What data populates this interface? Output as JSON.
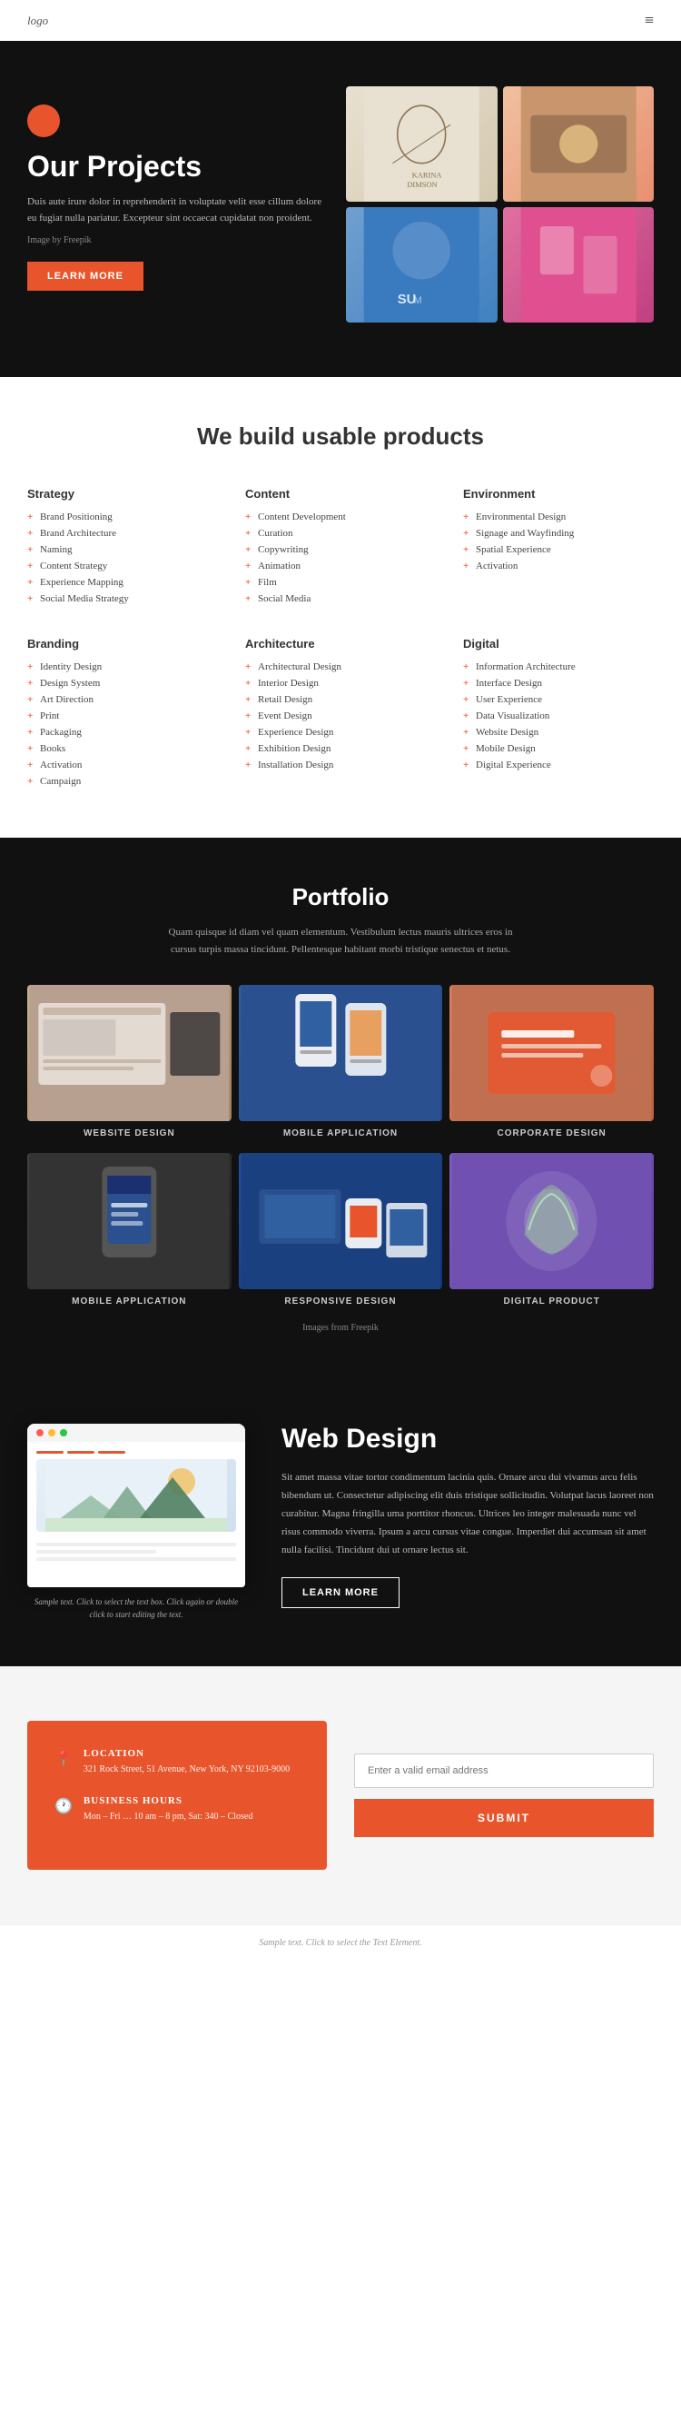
{
  "header": {
    "logo": "logo",
    "menu_icon": "≡"
  },
  "hero": {
    "title": "Our Projects",
    "description": "Duis aute irure dolor in reprehenderit in voluptate velit esse cillum dolore eu fugiat nulla pariatur. Excepteur sint occaecat cupidatat non proident.",
    "credit": "Image by Freepik",
    "btn_label": "LEARN MORE"
  },
  "services": {
    "section_title": "We build usable products",
    "columns": [
      {
        "heading": "Strategy",
        "items": [
          "Brand Positioning",
          "Brand Architecture",
          "Naming",
          "Content Strategy",
          "Experience Mapping",
          "Social Media Strategy"
        ]
      },
      {
        "heading": "Content",
        "items": [
          "Content Development",
          "Curation",
          "Copywriting",
          "Animation",
          "Film",
          "Social Media"
        ]
      },
      {
        "heading": "Environment",
        "items": [
          "Environmental Design",
          "Signage and Wayfinding",
          "Spatial Experience",
          "Activation"
        ]
      },
      {
        "heading": "Branding",
        "items": [
          "Identity Design",
          "Design System",
          "Art Direction",
          "Print",
          "Packaging",
          "Books",
          "Activation",
          "Campaign"
        ]
      },
      {
        "heading": "Architecture",
        "items": [
          "Architectural Design",
          "Interior Design",
          "Retail Design",
          "Event Design",
          "Experience Design",
          "Exhibition Design",
          "Installation Design"
        ]
      },
      {
        "heading": "Digital",
        "items": [
          "Information Architecture",
          "Interface Design",
          "User Experience",
          "Data Visualization",
          "Website Design",
          "Mobile Design",
          "Digital Experience"
        ]
      }
    ]
  },
  "portfolio": {
    "section_title": "Portfolio",
    "description": "Quam quisque id diam vel quam elementum. Vestibulum lectus mauris ultrices eros in cursus turpis massa tincidunt. Pellentesque habitant morbi tristique senectus et netus.",
    "items": [
      {
        "label": "WEBSITE DESIGN"
      },
      {
        "label": "MOBILE APPLICATION"
      },
      {
        "label": "CORPORATE DESIGN"
      },
      {
        "label": "MOBILE APPLICATION"
      },
      {
        "label": "RESPONSIVE DESIGN"
      },
      {
        "label": "DIGITAL PRODUCT"
      }
    ],
    "credit": "Images from Freepik"
  },
  "webdesign": {
    "section_title": "Web Design",
    "description": "Sit amet massa vitae tortor condimentum lacinia quis. Ornare arcu dui vivamus arcu felis bibendum ut. Consectetur adipiscing elit duis tristique sollicitudin. Volutpat lacus laoreet non curabitur. Magna fringilla uma porttitor rhoncus. Ultrices leo integer malesuada nunc vel risus commodo viverra. Ipsum a arcu cursus vitae congue. Imperdiet dui accumsan sit amet nulla facilisi. Tincidunt dui ut ornare lectus sit.",
    "btn_label": "LEARN MORE",
    "mockup_caption": "Sample text. Click to select the text box. Click again or double click to start editing the text."
  },
  "contact": {
    "location_label": "LOCATION",
    "location_value": "321 Rock Street, 51 Avenue, New York, NY 92103-9000",
    "hours_label": "BUSINESS HOURS",
    "hours_value": "Mon – Fri … 10 am – 8 pm, Sat: 340 – Closed",
    "email_placeholder": "Enter a valid email address",
    "submit_label": "SUBMIT"
  },
  "footer": {
    "text": "Sample text. Click to select the Text Element."
  }
}
